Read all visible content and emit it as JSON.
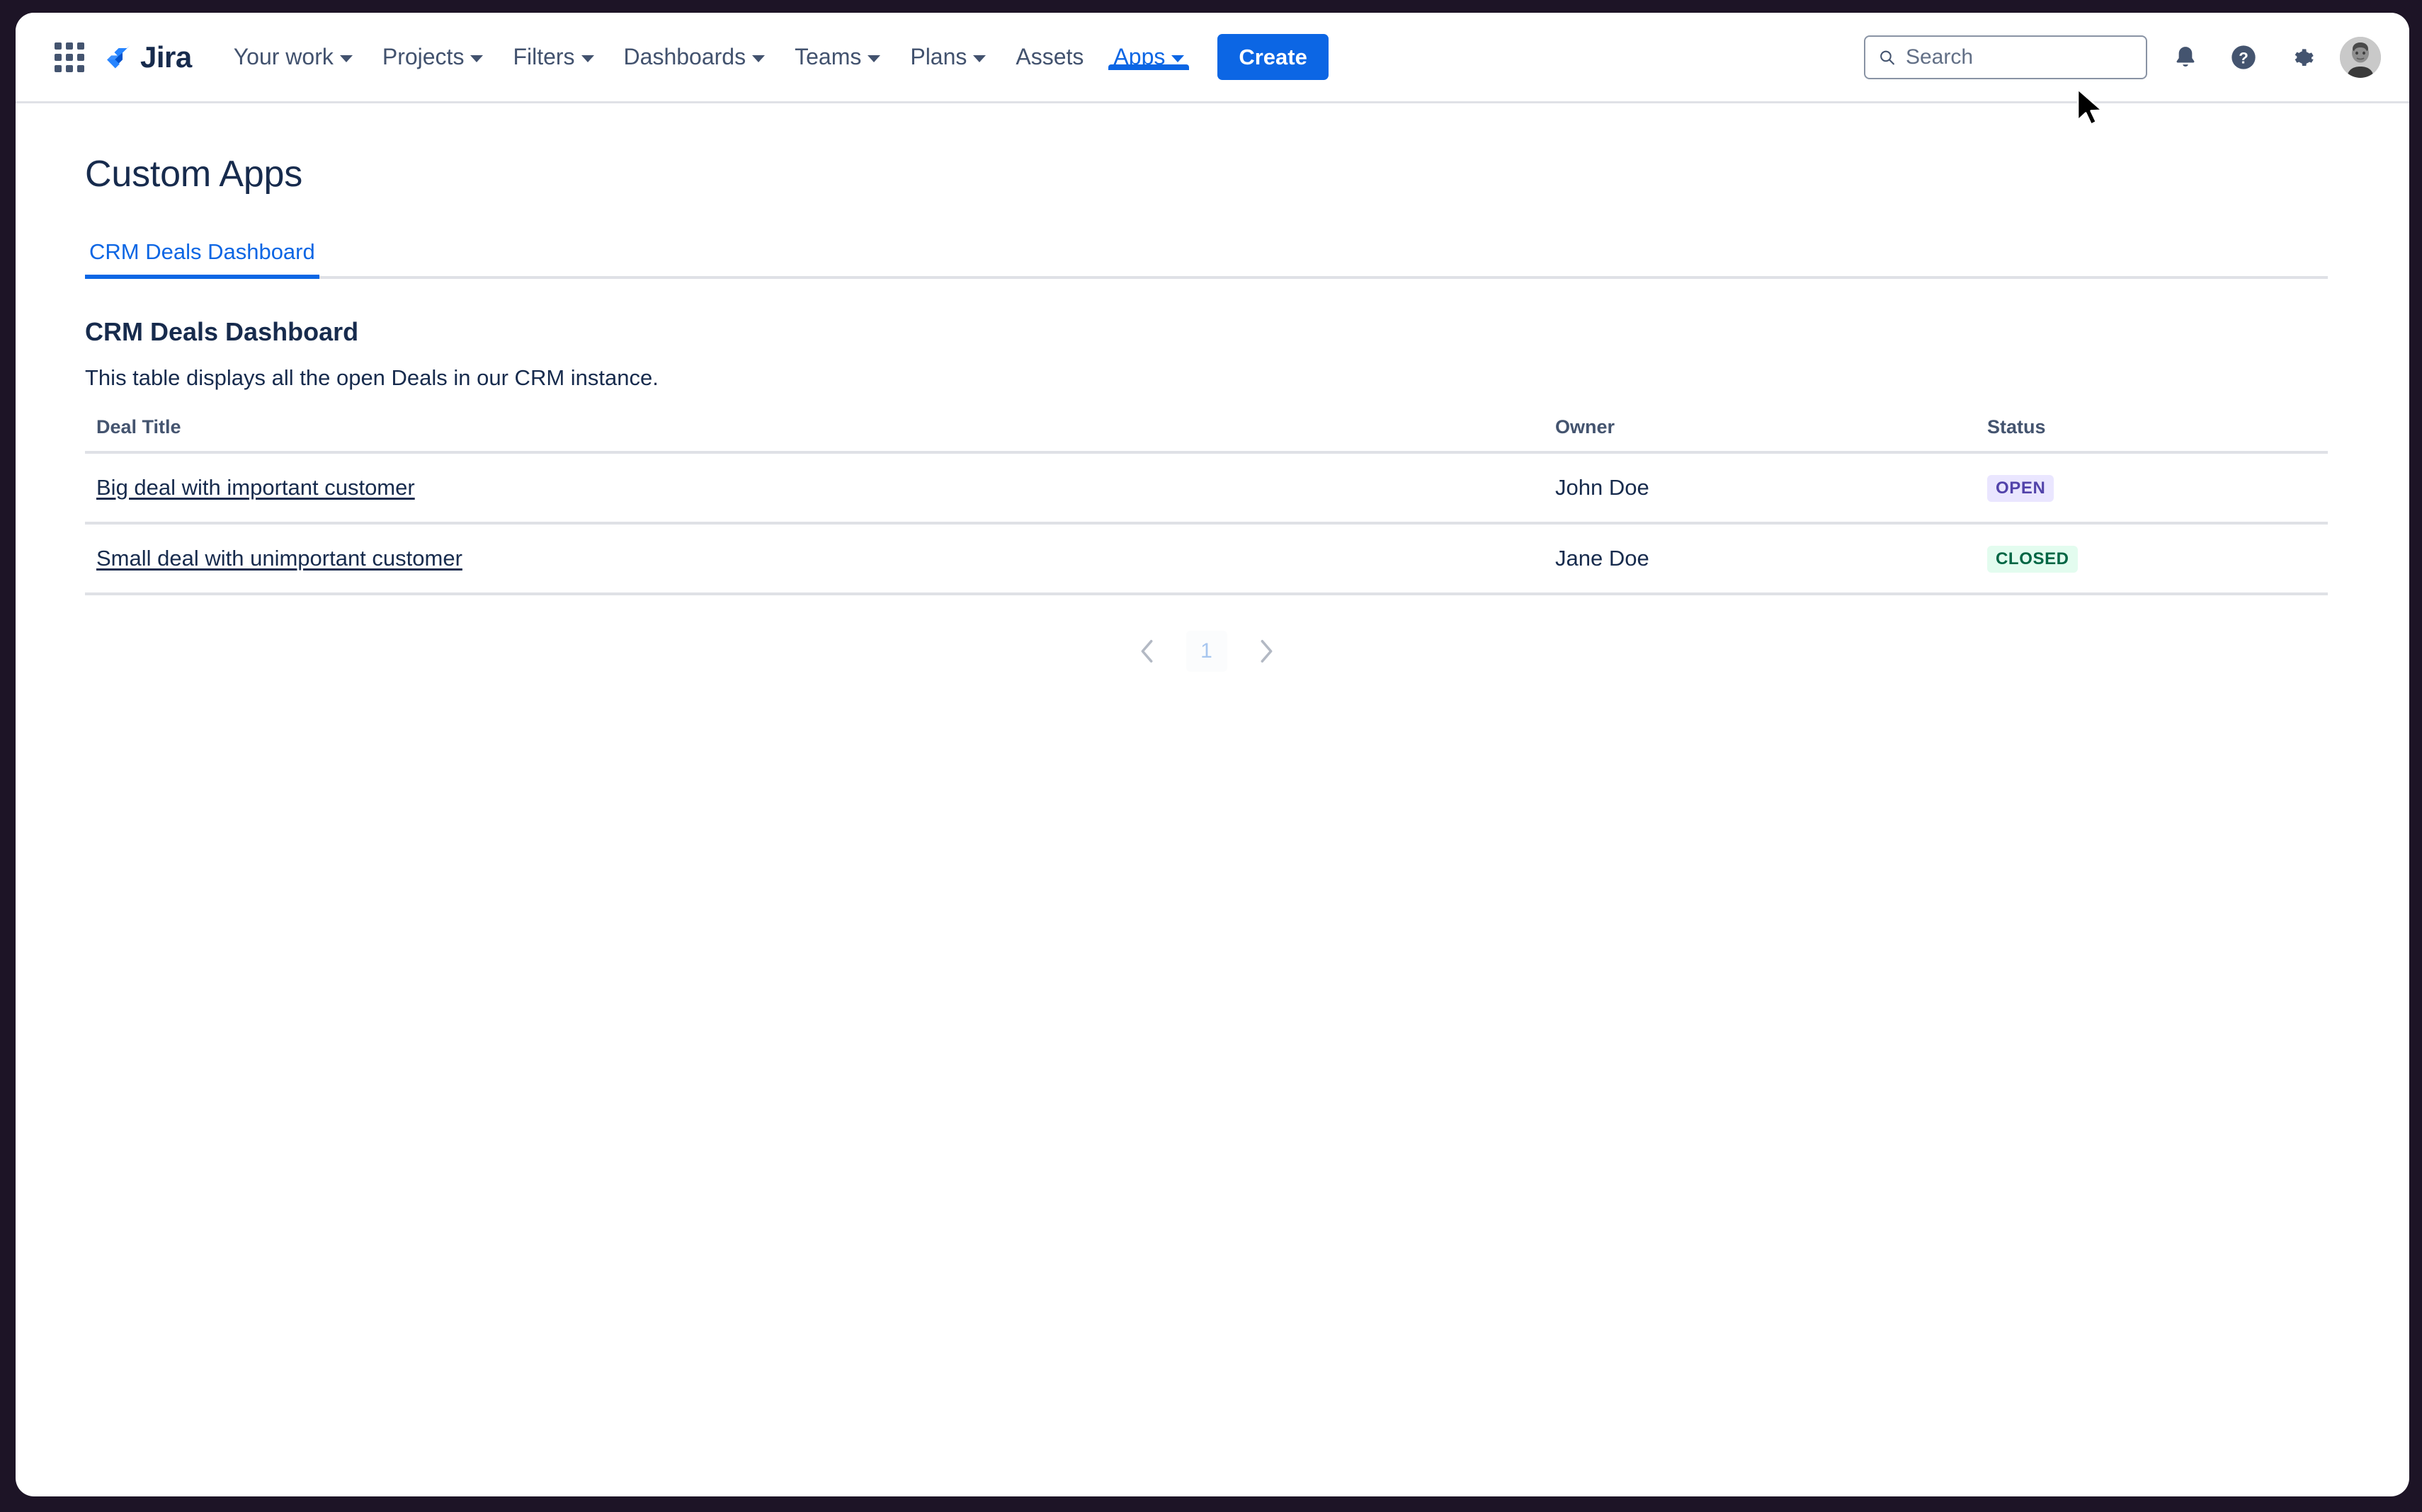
{
  "nav": {
    "app_switcher_label": "App switcher",
    "logo_text": "Jira",
    "items": [
      {
        "label": "Your work",
        "has_caret": true,
        "active": false
      },
      {
        "label": "Projects",
        "has_caret": true,
        "active": false
      },
      {
        "label": "Filters",
        "has_caret": true,
        "active": false
      },
      {
        "label": "Dashboards",
        "has_caret": true,
        "active": false
      },
      {
        "label": "Teams",
        "has_caret": true,
        "active": false
      },
      {
        "label": "Plans",
        "has_caret": true,
        "active": false
      },
      {
        "label": "Assets",
        "has_caret": false,
        "active": false
      },
      {
        "label": "Apps",
        "has_caret": true,
        "active": true
      }
    ],
    "create_label": "Create",
    "search": {
      "placeholder": "Search",
      "value": ""
    },
    "icons": {
      "notifications": "notification-bell-icon",
      "help": "help-icon",
      "settings": "settings-gear-icon",
      "avatar": "user-avatar"
    }
  },
  "page": {
    "title": "Custom Apps"
  },
  "tabs": [
    {
      "label": "CRM Deals Dashboard",
      "active": true
    }
  ],
  "panel": {
    "heading": "CRM Deals Dashboard",
    "description": "This table displays all the open Deals in our CRM instance."
  },
  "table": {
    "columns": [
      "Deal Title",
      "Owner",
      "Status"
    ],
    "rows": [
      {
        "deal_title": "Big deal with important customer",
        "owner": "John Doe",
        "status": "OPEN",
        "status_variant": "open"
      },
      {
        "deal_title": "Small deal with unimportant customer",
        "owner": "Jane Doe",
        "status": "CLOSED",
        "status_variant": "closed"
      }
    ]
  },
  "pagination": {
    "prev_label": "Previous page",
    "next_label": "Next page",
    "current_page": "1"
  },
  "colors": {
    "brand_blue": "#0c66e4",
    "text_primary": "#172b4d",
    "text_subtle": "#44546f",
    "border": "#dfe1e6",
    "status_open_bg": "#eae6ff",
    "status_open_fg": "#5243aa",
    "status_closed_bg": "#e3fcef",
    "status_closed_fg": "#006644",
    "window_frame": "#1d1426"
  }
}
